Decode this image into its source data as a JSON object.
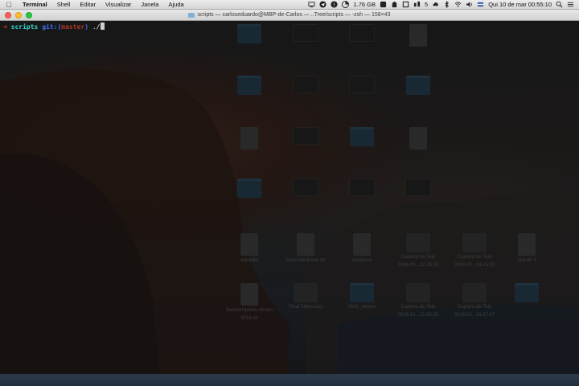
{
  "menubar": {
    "app_name": "Terminal",
    "items": [
      "Shell",
      "Editar",
      "Visualizar",
      "Janela",
      "Ajuda"
    ],
    "memory": "1.76 GB",
    "badge_count": "5",
    "clock": "Qui 10 de mar  00:55:10"
  },
  "terminal": {
    "title": "scripts — carloseduardo@MBP-de-Carlos — ..Tree/scripts — -zsh — 158×43",
    "prompt_arrow": "➜",
    "prompt_dir": "scripts",
    "prompt_git": "git:(",
    "prompt_branch": "master",
    "prompt_git_close": ")",
    "command": "./"
  },
  "desktop": {
    "icons": [
      {
        "label": "",
        "kind": "folder"
      },
      {
        "label": "",
        "kind": "shot"
      },
      {
        "label": "",
        "kind": "shot"
      },
      {
        "label": "",
        "kind": "doc"
      },
      {
        "label": "",
        "kind": "folder"
      },
      {
        "label": "",
        "kind": "shot"
      },
      {
        "label": "",
        "kind": "shot"
      },
      {
        "label": "",
        "kind": "folder"
      },
      {
        "label": "",
        "kind": "doc"
      },
      {
        "label": "",
        "kind": "shot"
      },
      {
        "label": "",
        "kind": "folder"
      },
      {
        "label": "",
        "kind": "doc"
      },
      {
        "label": "",
        "kind": "folder"
      },
      {
        "label": "",
        "kind": "shot"
      },
      {
        "label": "",
        "kind": "shot"
      },
      {
        "label": "",
        "kind": "shot"
      },
      {
        "label": "appdata",
        "kind": "doc"
      },
      {
        "label": "Send database.sh",
        "kind": "doc"
      },
      {
        "label": "database",
        "kind": "doc"
      },
      {
        "label": "Captura de Tela\n2016-01...12.25.33",
        "kind": "img"
      },
      {
        "label": "Captura de Tela\n2016-02...14.15.03",
        "kind": "img"
      },
      {
        "label": "update 3",
        "kind": "doc"
      },
      {
        "label": "ServiceUpdate.sh-iver\n2016.sh",
        "kind": "doc"
      },
      {
        "label": "Final Slides.key",
        "kind": "img"
      },
      {
        "label": "MAS_tokens",
        "kind": "folder"
      },
      {
        "label": "Captura de Tela\n2016-01...21.03.05",
        "kind": "img"
      },
      {
        "label": "Captura de Tela\n2016-02...16.27.47",
        "kind": "img"
      },
      {
        "label": "",
        "kind": "folder"
      }
    ]
  }
}
